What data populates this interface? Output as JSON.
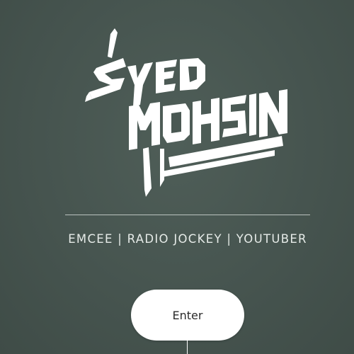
{
  "logo": {
    "name": "Syed Mohsin",
    "color": "#ffffff"
  },
  "tagline": "EMCEE | RADIO JOCKEY | YOUTUBER",
  "enter_button": {
    "label": "Enter"
  },
  "colors": {
    "background": "#4a5853",
    "divider": "#cfd6d2",
    "button_bg": "#ffffff",
    "button_text": "#2b2b2b"
  }
}
